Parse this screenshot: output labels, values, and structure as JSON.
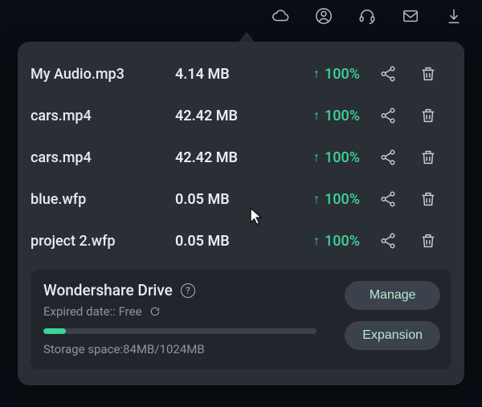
{
  "files": [
    {
      "name": "My Audio.mp3",
      "size": "4.14 MB",
      "progress": "100%"
    },
    {
      "name": "cars.mp4",
      "size": "42.42 MB",
      "progress": "100%"
    },
    {
      "name": "cars.mp4",
      "size": "42.42 MB",
      "progress": "100%"
    },
    {
      "name": "blue.wfp",
      "size": "0.05 MB",
      "progress": "100%"
    },
    {
      "name": "project 2.wfp",
      "size": "0.05 MB",
      "progress": "100%"
    }
  ],
  "drive": {
    "title": "Wondershare Drive",
    "expired_label": "Expired date:: Free",
    "storage_label": "Storage space:84MB/1024MB",
    "storage_used": 84,
    "storage_total": 1024,
    "progress_percent": 8.2
  },
  "buttons": {
    "manage": "Manage",
    "expansion": "Expansion"
  },
  "colors": {
    "accent_green": "#3dd598",
    "panel_bg": "#2a2f36",
    "text": "#e9ecef"
  }
}
